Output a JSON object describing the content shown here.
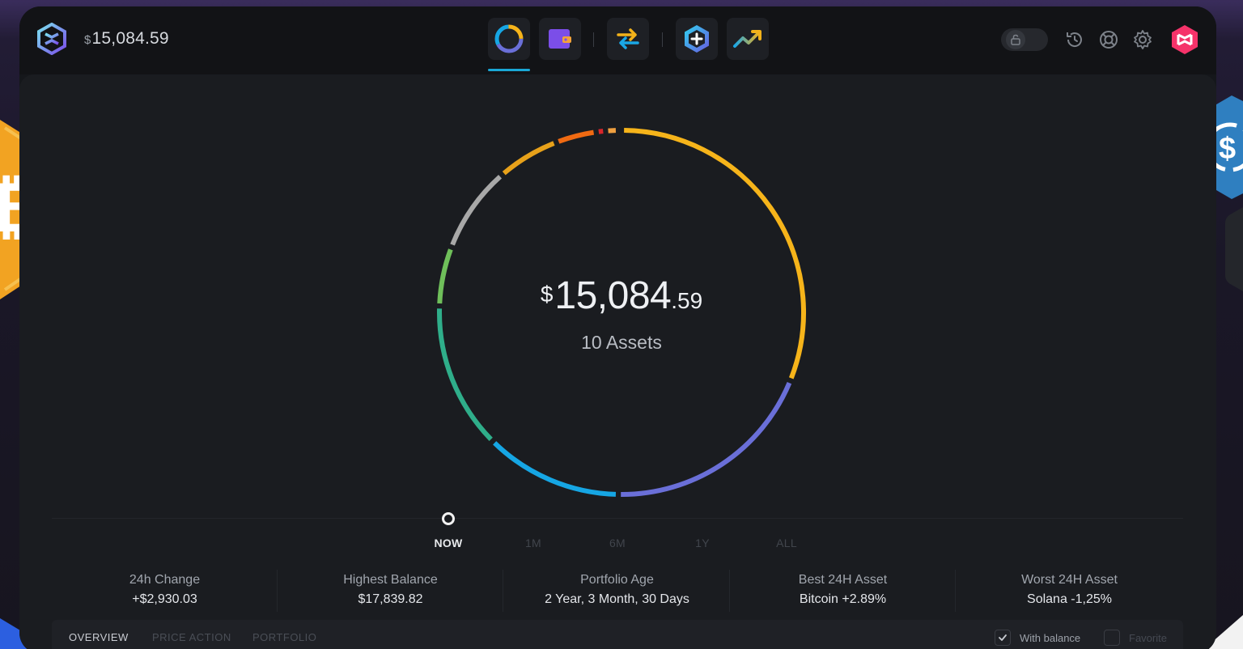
{
  "header": {
    "balance_currency": "$",
    "balance_value": "15,084.59"
  },
  "nav": {
    "items": [
      {
        "name": "portfolio",
        "icon": "donut-chart-icon",
        "active": true
      },
      {
        "name": "wallet",
        "icon": "wallet-icon",
        "active": false
      },
      {
        "name": "exchange",
        "icon": "swap-arrows-icon",
        "active": false
      },
      {
        "name": "add-asset",
        "icon": "hex-plus-icon",
        "active": false
      },
      {
        "name": "trends",
        "icon": "trend-chart-icon",
        "active": false
      }
    ]
  },
  "portfolio": {
    "total_currency": "$",
    "total_integer": "15,084",
    "total_decimal": ".59",
    "assets_label": "10 Assets",
    "allocation_colors": [
      "#f6b41a",
      "#6a6fd8",
      "#16a6e4",
      "#2fae8a",
      "#6fbf5a",
      "#a8a8a8",
      "#e7a11a",
      "#f06a12",
      "#d9262b",
      "#f0a040"
    ]
  },
  "timeline": {
    "options": [
      "NOW",
      "1M",
      "6M",
      "1Y",
      "ALL"
    ],
    "selected": "NOW"
  },
  "stats": [
    {
      "label": "24h Change",
      "value": "+$2,930.03"
    },
    {
      "label": "Highest Balance",
      "value": "$17,839.82"
    },
    {
      "label": "Portfolio Age",
      "value": "2 Year, 3 Month, 30 Days"
    },
    {
      "label": "Best 24H Asset",
      "value": "Bitcoin +2.89%"
    },
    {
      "label": "Worst 24H Asset",
      "value": "Solana -1,25%"
    }
  ],
  "tabs": [
    "OVERVIEW",
    "PRICE ACTION",
    "PORTFOLIO"
  ],
  "filters": {
    "with_balance": "With balance",
    "favorite": "Favorite"
  },
  "colors": {
    "accent": "#1aa7d6",
    "avatar": "#f5336a"
  }
}
